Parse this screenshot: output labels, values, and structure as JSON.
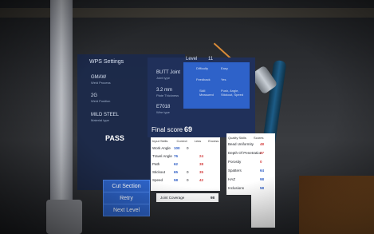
{
  "wps": {
    "title": "WPS Settings",
    "level_label": "Level",
    "level_value": "11",
    "process": {
      "value": "GMAW",
      "caption": "Weld Process"
    },
    "position": {
      "value": "2G",
      "caption": "Weld Position"
    },
    "material": {
      "value": "MILD STEEL",
      "caption": "Material type"
    },
    "joint": {
      "value": "BUTT Joint",
      "caption": "Joint type"
    },
    "thickness": {
      "value": "3.2 mm",
      "caption": "Plate Thickness"
    },
    "electrode": {
      "value": "E7018",
      "caption": "Wire type"
    }
  },
  "level": {
    "difficulty_label": "Difficulty",
    "difficulty_value": "Easy",
    "feedback_label": "Feedback",
    "feedback_value": "Yes",
    "skill_label": "Skill Measured",
    "skill_value": "Push, Angle, Stickout, Speed"
  },
  "result": {
    "status": "PASS"
  },
  "buttons": {
    "cut_section": "Cut Section",
    "retry": "Retry",
    "next_level": "Next Level"
  },
  "score": {
    "label": "Final score",
    "value": "69",
    "input_headers": [
      "Input Skills",
      "Correct",
      "Less",
      "Excess"
    ],
    "input_rows": [
      [
        "Work Angle",
        "100",
        "0",
        ""
      ],
      [
        "Travel Angle",
        "76",
        "",
        "24"
      ],
      [
        "Path",
        "62",
        "",
        "38"
      ],
      [
        "Stickout",
        "65",
        "0",
        "35"
      ],
      [
        "Speed",
        "58",
        "0",
        "42"
      ]
    ],
    "quality_headers": [
      "Quality Skills",
      "Scores"
    ],
    "quality_rows": [
      [
        "Bead Uniformity",
        "48"
      ],
      [
        "Depth Of Penetration",
        "27"
      ],
      [
        "Porosity",
        "0"
      ],
      [
        "Spatters",
        "64"
      ],
      [
        "HAZ",
        "98"
      ],
      [
        "Inclusions",
        "58"
      ]
    ],
    "joint_coverage": {
      "label": "Joint Coverage",
      "value": "98"
    }
  }
}
